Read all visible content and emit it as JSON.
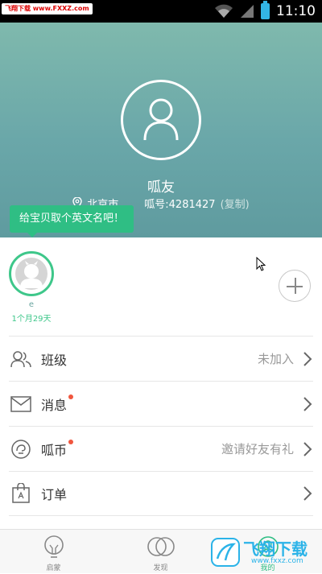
{
  "status_bar": {
    "watermark": "飞翔下载 www.FXXZ.com",
    "time": "11:10"
  },
  "profile": {
    "name": "呱友",
    "location": "北京市",
    "id_label": "呱号:4281427",
    "copy_label": "(复制)"
  },
  "tooltip": "给宝贝取个英文名吧！",
  "baby": {
    "name": "e",
    "age": "1个月29天"
  },
  "menu": [
    {
      "label": "班级",
      "value": "未加入",
      "dot": false
    },
    {
      "label": "消息",
      "value": "",
      "dot": true
    },
    {
      "label": "呱币",
      "value": "邀请好友有礼",
      "dot": true
    },
    {
      "label": "订单",
      "value": "",
      "dot": false
    }
  ],
  "tabs": [
    {
      "label": "启蒙",
      "icon": "lightbulb-icon"
    },
    {
      "label": "发现",
      "icon": "rings-icon"
    },
    {
      "label": "我的",
      "icon": "profile-icon"
    }
  ],
  "watermark_bottom": {
    "text": "飞翔下载",
    "sub": "www.fxxz.com"
  },
  "colors": {
    "accent": "#2fbe84",
    "header": "#6aa7a9",
    "dot": "#f0563e"
  }
}
